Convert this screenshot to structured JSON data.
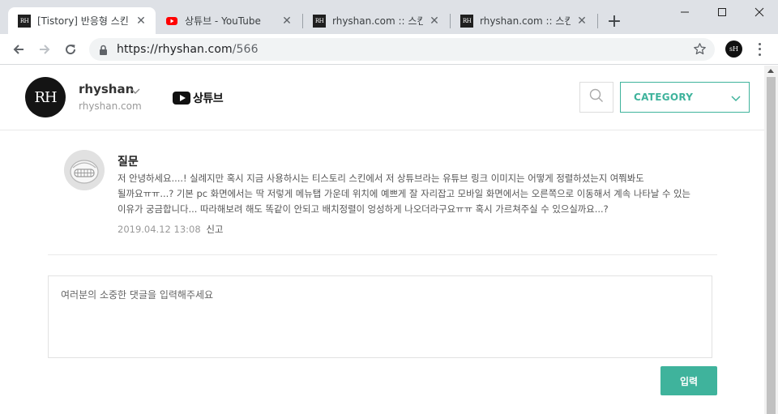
{
  "browser": {
    "tabs": [
      {
        "title": "[Tistory] 반응형 스킨 S",
        "favicon": "rh-favicon-icon",
        "active": true
      },
      {
        "title": "상튜브 - YouTube",
        "favicon": "youtube-favicon-icon",
        "active": false
      },
      {
        "title": "rhyshan.com :: 스킨편",
        "favicon": "rh-favicon-icon",
        "active": false
      },
      {
        "title": "rhyshan.com :: 스킨편",
        "favicon": "rh-favicon-icon",
        "active": false
      }
    ],
    "favicon_text": "RH",
    "url_host": "https://rhyshan.com",
    "url_path": "/566",
    "profile_initials": "sH"
  },
  "site": {
    "logo_text": "RH",
    "blog_name": "rhyshan",
    "blog_url": "rhyshan.com",
    "youtube_label": "상튜브",
    "category_label": "CATEGORY",
    "accent_color": "#3fb39c"
  },
  "comment": {
    "author": "질문",
    "body": "저 안녕하세요....! 실례지만 혹시 지금 사용하시는 티스토리 스킨에서 저 상튜브라는 유튜브 링크 이미지는 어떻게 정렬하셨는지 여쭤봐도 될까요ㅠㅠ...? 기본 pc 화면에서는 딱 저렇게 메뉴탭 가운데 위치에 예쁘게 잘 자리잡고 모바일 화면에서는 오른쪽으로 이동해서 계속 나타날 수 있는 이유가 궁금합니다... 따라해보려 해도 똑같이 안되고 배치정렬이 엉성하게 나오더라구요ㅠㅠ 혹시 가르쳐주실 수 있으실까요...?",
    "timestamp": "2019.04.12 13:08",
    "report_label": "신고"
  },
  "reply": {
    "placeholder": "여러분의 소중한 댓글을 입력해주세요",
    "value": "",
    "submit_label": "입력"
  }
}
